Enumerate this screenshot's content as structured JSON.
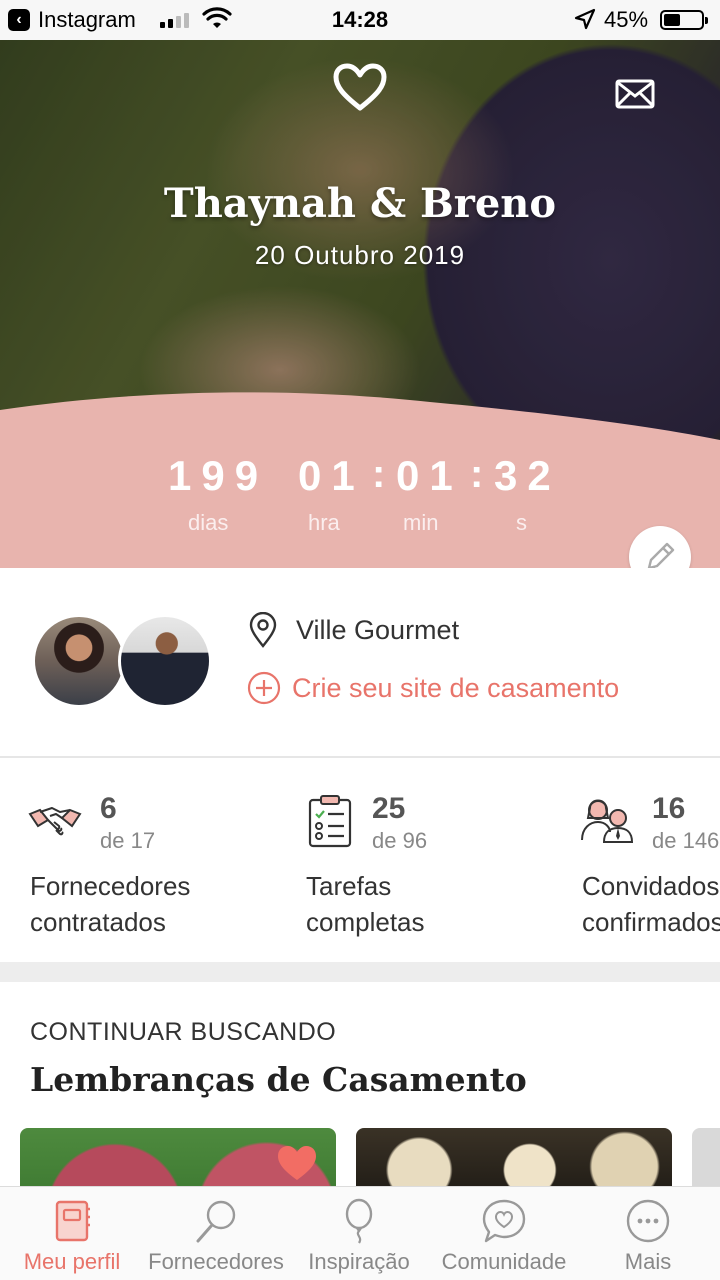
{
  "status_bar": {
    "back_app": "Instagram",
    "time": "14:28",
    "battery": "45%",
    "battery_level": 0.45,
    "signal_bars": 2
  },
  "hero": {
    "couple_names": "Thaynah & Breno",
    "wedding_date": "20 Outubro 2019",
    "countdown": {
      "days": "199",
      "hours": "01",
      "minutes": "01",
      "seconds": "32",
      "separator": ":",
      "days_label": "dias",
      "hours_label": "hra",
      "minutes_label": "min",
      "seconds_label": "s"
    },
    "accent_color": "#e8b4ae"
  },
  "profile": {
    "venue": "Ville Gourmet",
    "create_site_label": "Crie seu site de casamento"
  },
  "stats": [
    {
      "icon": "handshake-icon",
      "value": "6",
      "of": "de 17",
      "label_line1": "Fornecedores",
      "label_line2": "contratados"
    },
    {
      "icon": "checklist-icon",
      "value": "25",
      "of": "de 96",
      "label_line1": "Tarefas",
      "label_line2": "completas"
    },
    {
      "icon": "guests-icon",
      "value": "16",
      "of": "de 146",
      "label_line1": "Convidados",
      "label_line2": "confirmados"
    }
  ],
  "continue": {
    "kicker": "CONTINUAR BUSCANDO",
    "title": "Lembranças de Casamento"
  },
  "tabs": [
    {
      "label": "Meu perfil",
      "icon": "notebook-icon",
      "active": true
    },
    {
      "label": "Fornecedores",
      "icon": "search-icon",
      "active": false
    },
    {
      "label": "Inspiração",
      "icon": "balloon-icon",
      "active": false
    },
    {
      "label": "Comunidade",
      "icon": "chat-heart-icon",
      "active": false
    },
    {
      "label": "Mais",
      "icon": "more-icon",
      "active": false
    }
  ],
  "colors": {
    "brand": "#e8746a",
    "pink": "#e8b4ae"
  }
}
